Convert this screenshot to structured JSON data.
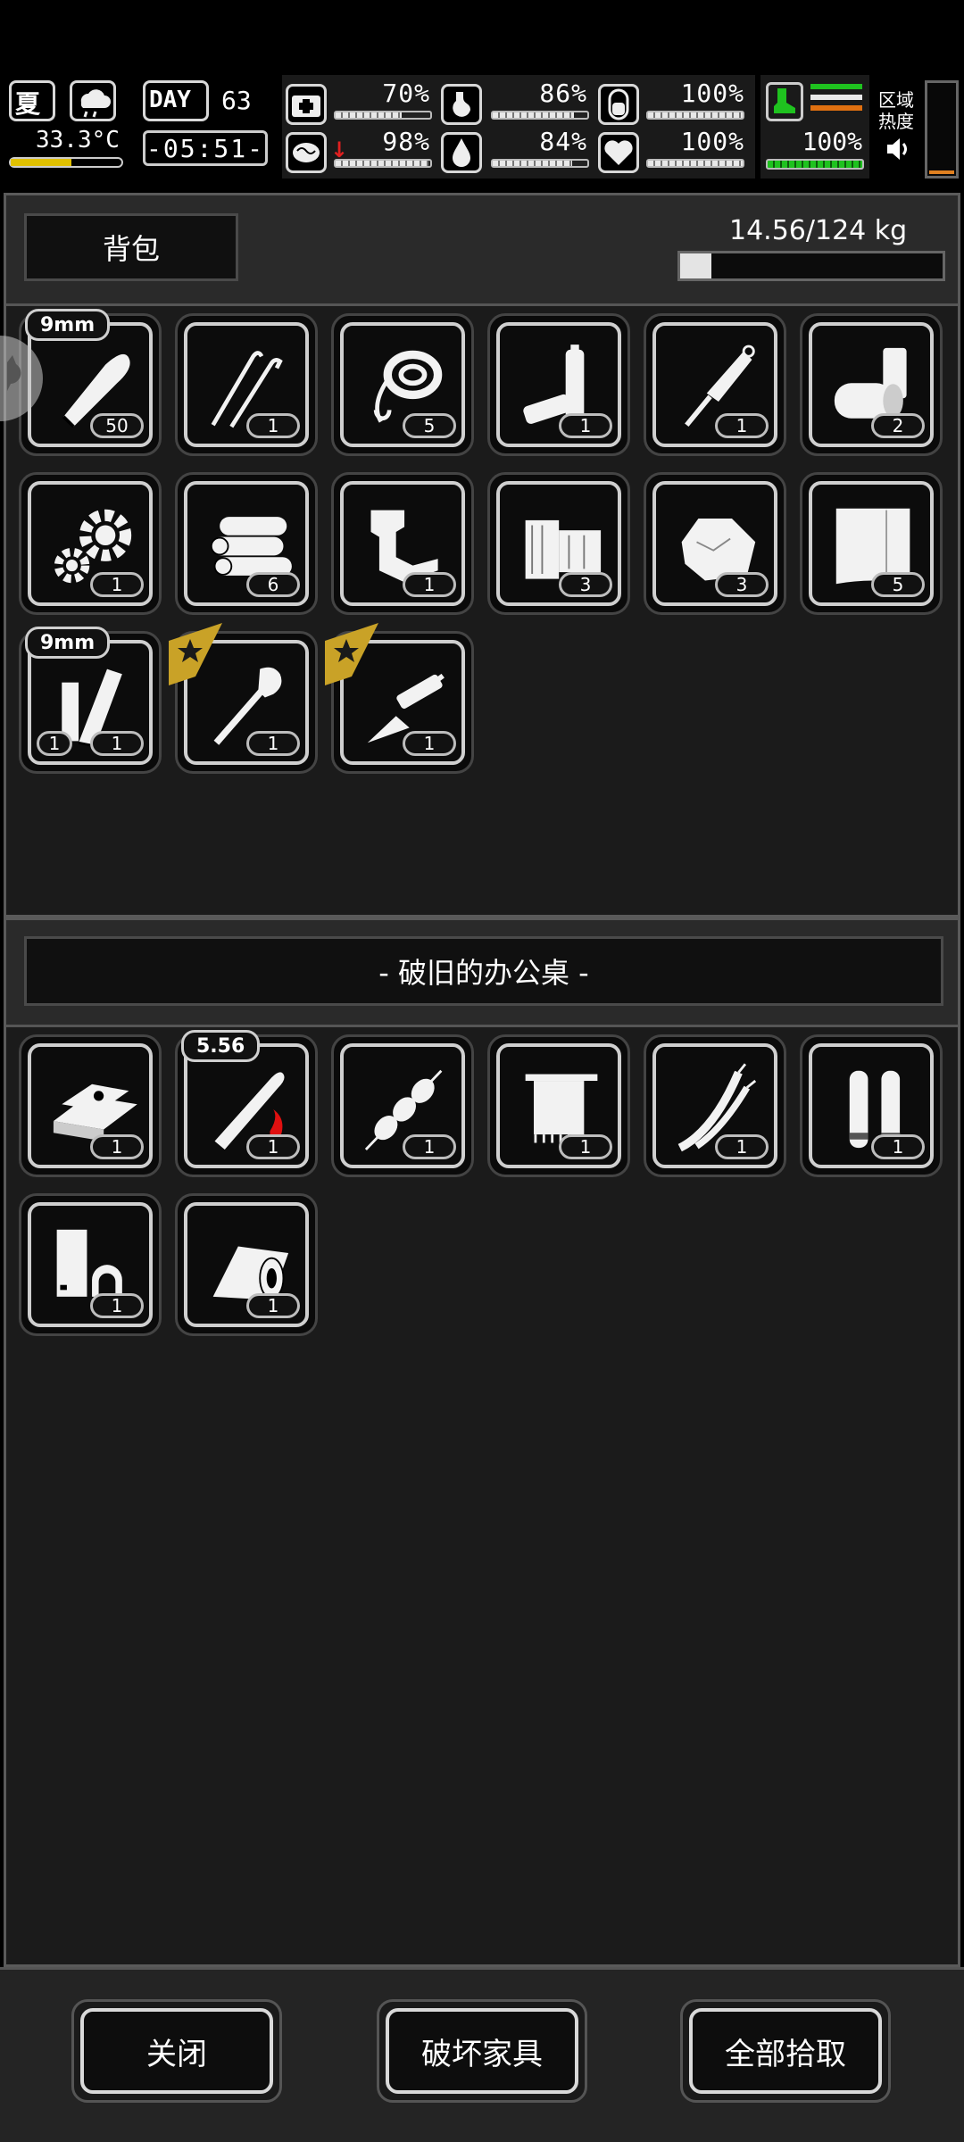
{
  "status": {
    "season": "夏",
    "temperature": "33.3°C",
    "day_label": "DAY",
    "day_number": "63",
    "clock": "-05:51-",
    "stats": [
      {
        "name": "health",
        "value": "70%",
        "fill": 0.7
      },
      {
        "name": "stomach",
        "value": "86%",
        "fill": 0.86
      },
      {
        "name": "stamina",
        "value": "100%",
        "fill": 1.0
      },
      {
        "name": "brain",
        "value": "98%",
        "fill": 0.98
      },
      {
        "name": "water",
        "value": "84%",
        "fill": 0.84
      },
      {
        "name": "heart",
        "value": "100%",
        "fill": 1.0
      }
    ],
    "leg_value": "100%",
    "zone_heat_label": "区域\n热度"
  },
  "backpack": {
    "title": "背包",
    "weight": "14.56/124 kg",
    "weight_fill": 0.1174,
    "items": [
      {
        "icon": "bullet-icon",
        "count": "50",
        "tag": "9mm"
      },
      {
        "icon": "lockpick-icon",
        "count": "1"
      },
      {
        "icon": "rope-icon",
        "count": "5"
      },
      {
        "icon": "battery-icon",
        "count": "1"
      },
      {
        "icon": "screwdriver-icon",
        "count": "1"
      },
      {
        "icon": "can-icon",
        "count": "2"
      },
      {
        "icon": "gear-icon",
        "count": "1"
      },
      {
        "icon": "logs-icon",
        "count": "6"
      },
      {
        "icon": "scrap-icon",
        "count": "1"
      },
      {
        "icon": "planks-icon",
        "count": "3"
      },
      {
        "icon": "ore-icon",
        "count": "3"
      },
      {
        "icon": "cloth-icon",
        "count": "5"
      },
      {
        "icon": "magazine-icon",
        "count": "1",
        "count_left": "1",
        "tag": "9mm"
      },
      {
        "icon": "shovel-icon",
        "count": "1",
        "star": true
      },
      {
        "icon": "knife-icon",
        "count": "1",
        "star": true
      }
    ]
  },
  "container": {
    "title": "- 破旧的办公桌 -",
    "items": [
      {
        "icon": "gold-bar-icon",
        "count": "1"
      },
      {
        "icon": "rifle-bullet-icon",
        "count": "1",
        "tag": "5.56"
      },
      {
        "icon": "skewer-icon",
        "count": "1"
      },
      {
        "icon": "towel-icon",
        "count": "1"
      },
      {
        "icon": "wire-icon",
        "count": "1"
      },
      {
        "icon": "tubes-icon",
        "count": "1"
      },
      {
        "icon": "glue-icon",
        "count": "1"
      },
      {
        "icon": "tape-icon",
        "count": "1"
      }
    ]
  },
  "buttons": {
    "close": "关闭",
    "destroy": "破坏家具",
    "take_all": "全部拾取"
  }
}
